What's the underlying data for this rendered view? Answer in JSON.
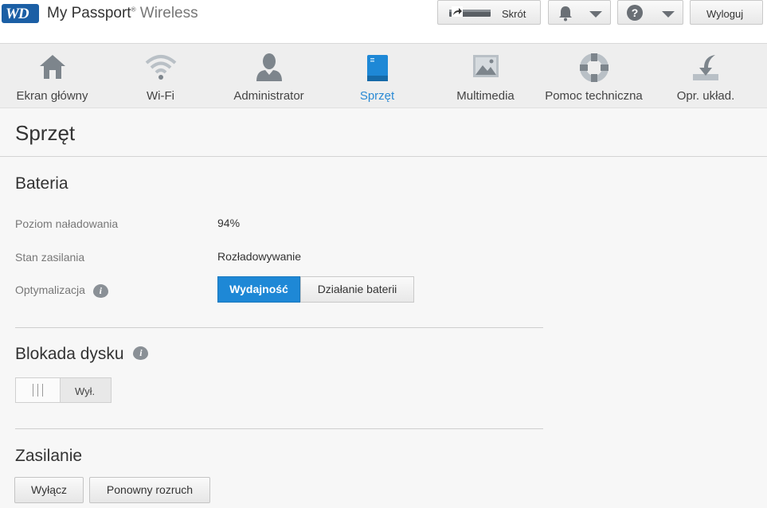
{
  "header": {
    "logo_text": "WD",
    "brand_bold": "My Passport",
    "brand_light": "Wireless",
    "shortcut_label": "Skrót",
    "logout_label": "Wyloguj",
    "help_symbol": "?",
    "icons": [
      "shortcut-icon",
      "bell-icon",
      "help-icon",
      "chevron-down-icon"
    ]
  },
  "nav": {
    "items": [
      {
        "label": "Ekran główny",
        "icon": "home-icon"
      },
      {
        "label": "Wi-Fi",
        "icon": "wifi-icon"
      },
      {
        "label": "Administrator",
        "icon": "user-icon"
      },
      {
        "label": "Sprzęt",
        "icon": "device-icon"
      },
      {
        "label": "Multimedia",
        "icon": "image-icon"
      },
      {
        "label": "Pomoc techniczna",
        "icon": "lifebuoy-icon"
      },
      {
        "label": "Opr. układ.",
        "icon": "firmware-download-icon"
      }
    ],
    "active_index": 3,
    "active_color": "#2a8ad4"
  },
  "page": {
    "title": "Sprzęt"
  },
  "battery": {
    "heading": "Bateria",
    "charge_label": "Poziom naładowania",
    "charge_value": "94%",
    "power_label": "Stan zasilania",
    "power_value": "Rozładowywanie",
    "optimization_label": "Optymalizacja",
    "info_symbol": "i",
    "opt_performance": "Wydajność",
    "opt_battery": "Działanie baterii",
    "selected": "Wydajność"
  },
  "disk_lock": {
    "heading": "Blokada dysku",
    "info_symbol": "i",
    "toggle_state": "Wył."
  },
  "power": {
    "heading": "Zasilanie",
    "shutdown_label": "Wyłącz",
    "restart_label": "Ponowny rozruch"
  },
  "colors": {
    "accent": "#1e88d6",
    "brand": "#1b5fa5",
    "icon_gray": "#7d858c"
  }
}
